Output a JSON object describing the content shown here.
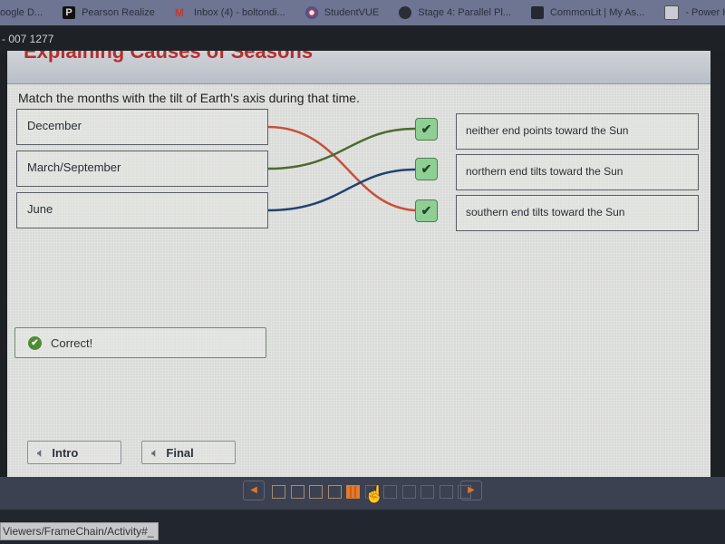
{
  "browser": {
    "bookmarks": [
      {
        "label": "oogle D...",
        "icon": "google-docs-icon"
      },
      {
        "label": "Pearson Realize",
        "icon": "pearson-icon"
      },
      {
        "label": "Inbox (4) - boltondi...",
        "icon": "gmail-icon"
      },
      {
        "label": "StudentVUE",
        "icon": "studentvue-icon"
      },
      {
        "label": "Stage 4: Parallel Pl...",
        "icon": "globe-icon"
      },
      {
        "label": "CommonLit | My As...",
        "icon": "book-icon"
      },
      {
        "label": "- Power Hour",
        "icon": "document-icon"
      },
      {
        "label": "",
        "icon": "quizlet-icon"
      }
    ],
    "url_fragment": "- 007  1277",
    "status_url": "Viewers/FrameChain/Activity#_"
  },
  "lesson": {
    "title": "Explaining Causes of Seasons",
    "prompt": "Match the months with the tilt of Earth's axis during that time.",
    "left_items": [
      "December",
      "March/September",
      "June"
    ],
    "right_items": [
      "neither end points toward the Sun",
      "northern end tilts toward the Sun",
      "southern end tilts toward the Sun"
    ],
    "matches": [
      {
        "left": "December",
        "right": "southern end tilts toward the Sun",
        "color": "#c9503a"
      },
      {
        "left": "March/September",
        "right": "neither end points toward the Sun",
        "color": "#4c6b2f"
      },
      {
        "left": "June",
        "right": "northern end tilts toward the Sun",
        "color": "#1f4470"
      }
    ],
    "check_mark": "✔",
    "feedback": "Correct!",
    "audio_buttons": [
      "Intro",
      "Final"
    ]
  },
  "pager": {
    "total_pages": 11,
    "completed_pages": 4,
    "current_page": 5,
    "accent_color": "#e37b2f"
  }
}
